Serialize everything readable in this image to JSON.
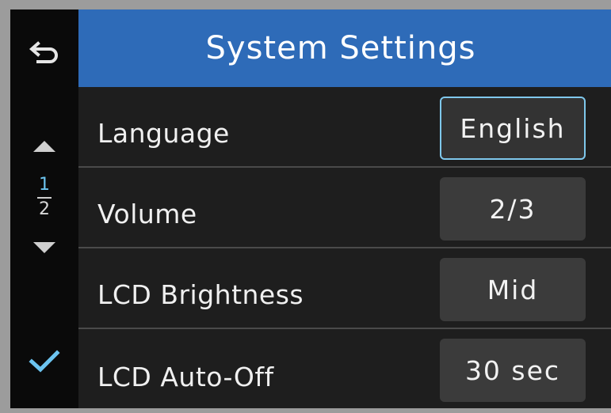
{
  "header": {
    "title": "System Settings",
    "background": "#2e6bb8"
  },
  "sidebar": {
    "back_icon": "back-arrow-icon",
    "up_icon": "triangle-up-icon",
    "down_icon": "triangle-down-icon",
    "confirm_icon": "checkmark-icon",
    "page_current": "1",
    "page_total": "2",
    "accent": "#6cc4f0"
  },
  "settings": [
    {
      "label": "Language",
      "value": "English",
      "focused": true
    },
    {
      "label": "Volume",
      "value": "2/3",
      "focused": false
    },
    {
      "label": "LCD Brightness",
      "value": "Mid",
      "focused": false
    },
    {
      "label": "LCD Auto-Off",
      "value": "30 sec",
      "focused": false
    }
  ]
}
